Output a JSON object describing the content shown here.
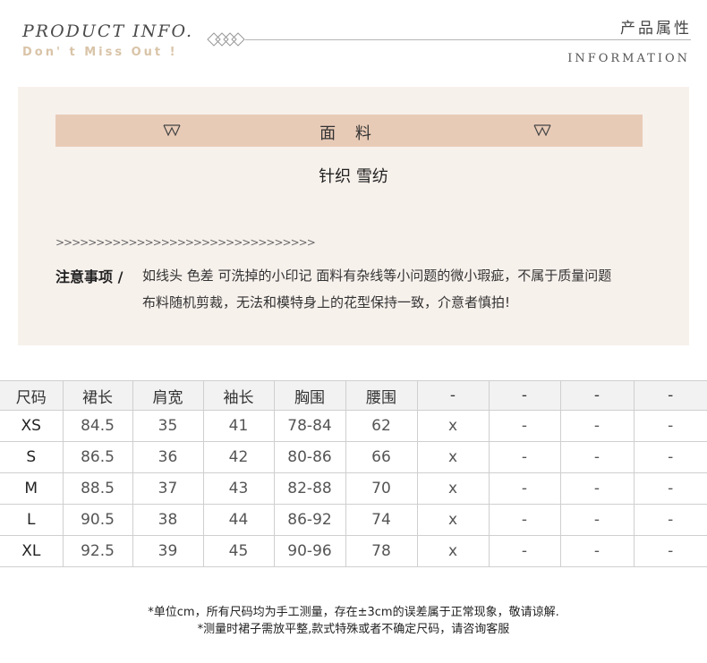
{
  "header": {
    "title": "PRODUCT   INFO.",
    "subtitle": "Don' t  Miss  Out !",
    "title_cn": "产品属性",
    "title_en": "INFORMATION",
    "accent_color": "#d9c4a8"
  },
  "panel": {
    "band_label": "面 料",
    "fabric": "针织 雪纺",
    "arrows": ">>>>>>>>>>>>>>>>>>>>>>>>>>>>>>>>",
    "note_label": "注意事项 /",
    "note_line1": "如线头 色差 可洗掉的小印记 面料有杂线等小问题的微小瑕疵，不属于质量问题",
    "note_line2": "布料随机剪裁，无法和模特身上的花型保持一致，介意者慎拍!",
    "band_color": "#e8cbb7",
    "panel_color": "#f7f1ec"
  },
  "size_table": {
    "headers": [
      "尺码",
      "裙长",
      "肩宽",
      "袖长",
      "胸围",
      "腰围",
      "-",
      "-",
      "-",
      "-"
    ],
    "rows": [
      [
        "XS",
        "84.5",
        "35",
        "41",
        "78-84",
        "62",
        "x",
        "-",
        "-",
        "-"
      ],
      [
        "S",
        "86.5",
        "36",
        "42",
        "80-86",
        "66",
        "x",
        "-",
        "-",
        "-"
      ],
      [
        "M",
        "88.5",
        "37",
        "43",
        "82-88",
        "70",
        "x",
        "-",
        "-",
        "-"
      ],
      [
        "L",
        "90.5",
        "38",
        "44",
        "86-92",
        "74",
        "x",
        "-",
        "-",
        "-"
      ],
      [
        "XL",
        "92.5",
        "39",
        "45",
        "90-96",
        "78",
        "x",
        "-",
        "-",
        "-"
      ]
    ]
  },
  "footer": {
    "note1": "*单位cm，所有尺码均为手工测量，存在±3cm的误差属于正常现象，敬请谅解.",
    "note2": "*测量时裙子需放平整,款式特殊或者不确定尺码，请咨询客服"
  }
}
